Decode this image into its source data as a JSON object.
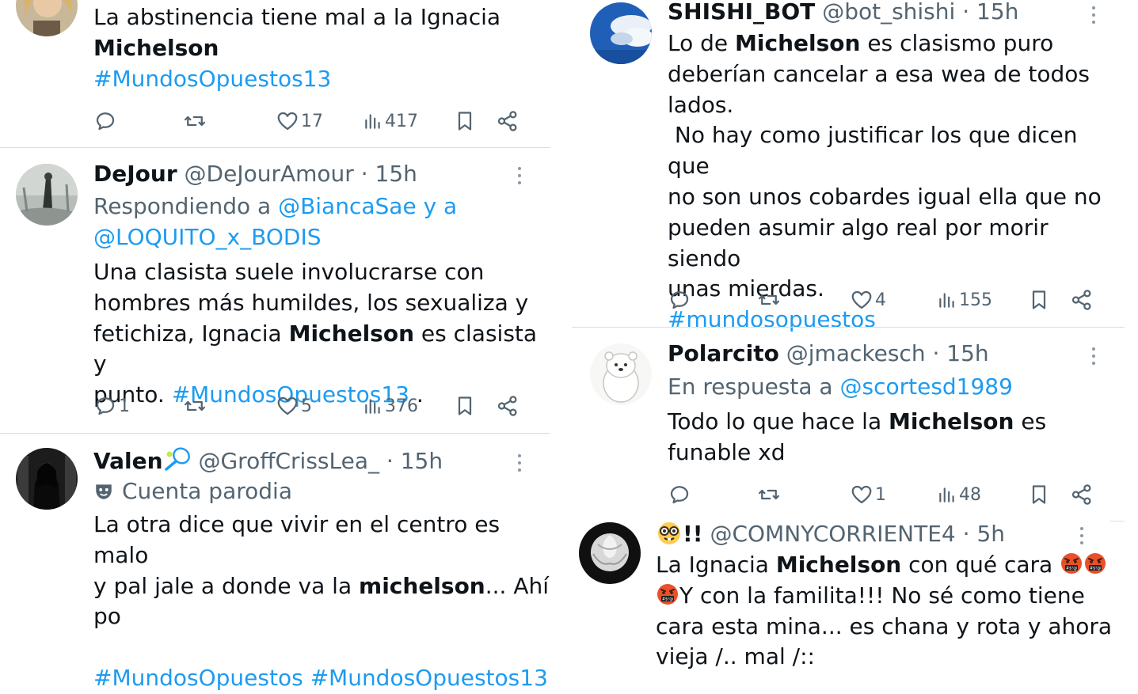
{
  "left_column": {
    "tweets": [
      {
        "body_lines": [
          [
            {
              "t": "La abstinencia tiene mal a la Ignacia"
            }
          ],
          [
            {
              "t": "Michelson",
              "b": true
            }
          ],
          [
            {
              "t": "#MundosOpuestos13",
              "link": true
            }
          ]
        ],
        "replies": "",
        "likes": "17",
        "views": "417"
      },
      {
        "name": "DeJour",
        "handle": "@DeJourAmour",
        "time": "· 15h",
        "reply_prefix": "Respondiendo a ",
        "reply_to_1": "@BiancaSae y a",
        "reply_to_2": "@LOQUITO_x_BODIS",
        "body_lines": [
          [
            {
              "t": "Una clasista suele involucrarse con"
            }
          ],
          [
            {
              "t": "hombres más humildes, los sexualiza y"
            }
          ],
          [
            {
              "t": "fetichiza, Ignacia "
            },
            {
              "t": "Michelson",
              "b": true
            },
            {
              "t": " es clasista y"
            }
          ],
          [
            {
              "t": "punto. "
            },
            {
              "t": "#MundosOpuestos13",
              "link": true
            },
            {
              "t": " ."
            }
          ]
        ],
        "replies": "1",
        "likes": "5",
        "views": "376"
      },
      {
        "name": "Valen",
        "handle": "@GroffCrissLea_",
        "time": "· 15h",
        "parody_label": "Cuenta parodia",
        "body_lines": [
          [
            {
              "t": "La otra dice que vivir en el centro es malo"
            }
          ],
          [
            {
              "t": "y pal jale a donde va la "
            },
            {
              "t": "michelson",
              "b": true
            },
            {
              "t": "... Ahí"
            }
          ],
          [
            {
              "t": "po"
            }
          ],
          [
            {
              "t": ""
            }
          ],
          [
            {
              "t": "#MundosOpuestos #MundosOpuestos13",
              "link": true
            }
          ]
        ]
      }
    ]
  },
  "right_column": {
    "tweets": [
      {
        "name": "SHISHI_BOT",
        "handle": "@bot_shishi",
        "time": "· 15h",
        "body_lines": [
          [
            {
              "t": "Lo de "
            },
            {
              "t": "Michelson",
              "b": true
            },
            {
              "t": " es clasismo puro"
            }
          ],
          [
            {
              "t": "deberían cancelar a esa wea de todos"
            }
          ],
          [
            {
              "t": "lados."
            }
          ],
          [
            {
              "t": " No hay como justificar los que dicen que"
            }
          ],
          [
            {
              "t": "no son unos cobardes igual ella que no"
            }
          ],
          [
            {
              "t": "pueden asumir algo real por morir siendo"
            }
          ],
          [
            {
              "t": "unas mierdas."
            }
          ],
          [
            {
              "t": "#mundosopuestos",
              "link": true
            }
          ]
        ],
        "replies": "",
        "likes": "4",
        "views": "155"
      },
      {
        "name": "Polarcito",
        "handle": "@jmackesch",
        "time": "· 15h",
        "reply_prefix": "En respuesta a ",
        "reply_to_1": "@scortesd1989",
        "body_lines": [
          [
            {
              "t": "Todo lo que hace la "
            },
            {
              "t": "Michelson",
              "b": true
            },
            {
              "t": " es"
            }
          ],
          [
            {
              "t": "funable xd"
            }
          ]
        ],
        "replies": "",
        "likes": "1",
        "views": "48"
      },
      {
        "name_suffix": "!!",
        "handle": "@COMNYCORRIENTE4",
        "time": "· 5h",
        "body_lines": [
          [
            {
              "t": "La Ignacia "
            },
            {
              "t": "Michelson",
              "b": true
            },
            {
              "t": " con qué cara "
            },
            {
              "emoji": "angry"
            },
            {
              "emoji": "angry"
            }
          ],
          [
            {
              "emoji": "angry"
            },
            {
              "t": "Y con la familita!!! No sé como tiene"
            }
          ],
          [
            {
              "t": "cara esta mina... es chana y rota y ahora"
            }
          ],
          [
            {
              "t": "vieja /.. mal /::"
            }
          ]
        ]
      }
    ]
  },
  "colors": {
    "link": "#1d9bf0",
    "text": "#0f1419",
    "muted": "#536471"
  }
}
